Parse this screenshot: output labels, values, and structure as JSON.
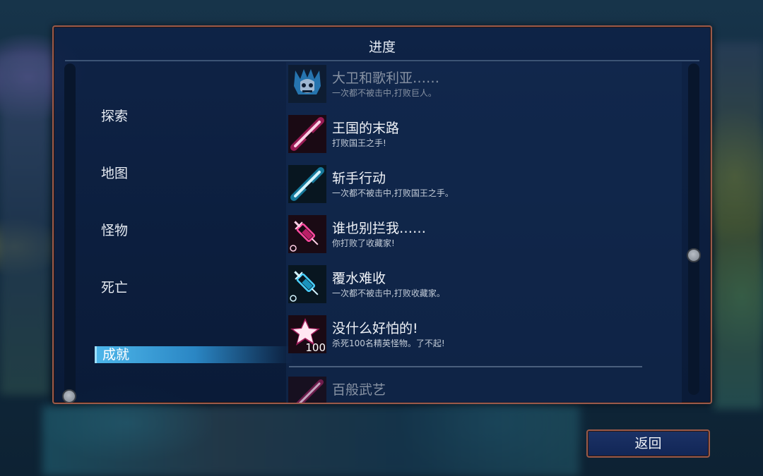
{
  "panel": {
    "title": "进度"
  },
  "categories": [
    {
      "label": "探索",
      "active": false
    },
    {
      "label": "地图",
      "active": false
    },
    {
      "label": "怪物",
      "active": false
    },
    {
      "label": "死亡",
      "active": false
    },
    {
      "label": "成就",
      "active": true
    }
  ],
  "achievements": [
    {
      "title": "大卫和歌利亚……",
      "desc": "一次都不被击中,打败巨人。",
      "icon": "skull-crown-icon",
      "state": "locked"
    },
    {
      "title": "王国的末路",
      "desc": "打败国王之手!",
      "icon": "pink-blade-icon",
      "state": "unlocked"
    },
    {
      "title": "斩手行动",
      "desc": "一次都不被击中,打败国王之手。",
      "icon": "blue-blade-icon",
      "state": "unlocked"
    },
    {
      "title": "谁也别拦我……",
      "desc": "你打败了收藏家!",
      "icon": "pink-syringe-icon",
      "state": "unlocked"
    },
    {
      "title": "覆水难收",
      "desc": "一次都不被击中,打败收藏家。",
      "icon": "blue-syringe-icon",
      "state": "unlocked"
    },
    {
      "title": "没什么好怕的!",
      "desc": "杀死100名精英怪物。了不起!",
      "icon": "star-100-icon",
      "icon_text": "100",
      "state": "unlocked"
    },
    {
      "title": "百般武艺",
      "desc": "",
      "icon": "pink-weapon-icon",
      "state": "locked"
    }
  ],
  "back_button": {
    "label": "返回"
  },
  "colors": {
    "panel_border": "#9a5a4a",
    "panel_bg": "#0e2246",
    "highlight": "#4db6ea",
    "neon_pink": "#ff2a8a",
    "neon_blue": "#22c8ff"
  }
}
